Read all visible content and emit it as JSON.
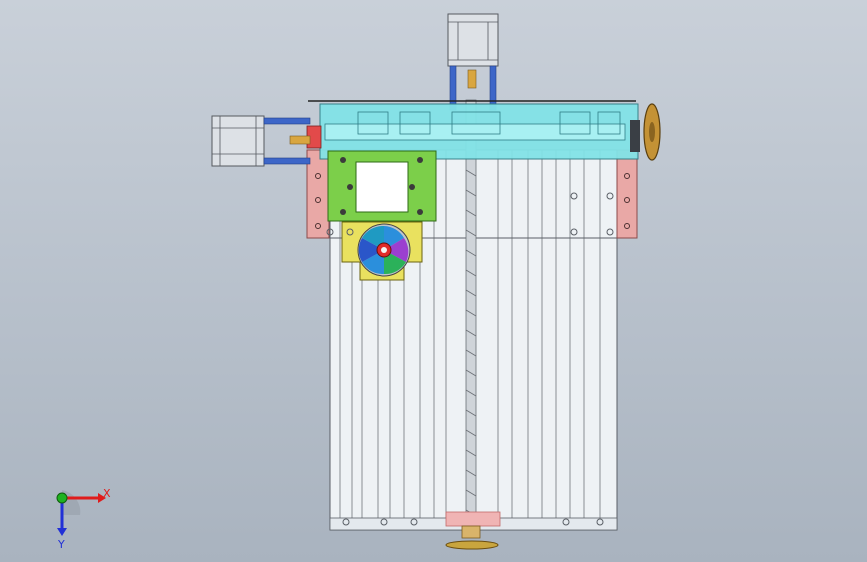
{
  "viewport": {
    "background_top": "#c9d0d9",
    "background_bottom": "#a9b3bf"
  },
  "model": {
    "colors": {
      "frame": "#e9eef2",
      "frame_line": "#5a5f66",
      "cyan_assembly": "#7fe3e6",
      "green_block": "#7cd44a",
      "pink_plate": "#e5a7a6",
      "yellow_bracket": "#e8df5a",
      "motor_body": "#d9dde2",
      "handwheel": "#b8872d",
      "red_part": "#e02a2a",
      "blue_rod": "#3a63c8"
    },
    "icons": [
      "stepper-motor-icon",
      "handwheel-icon",
      "fan-icon",
      "lead-screw-icon"
    ]
  },
  "triad": {
    "x_label": "X",
    "y_label": "Y",
    "x_color": "#e01b1b",
    "y_color": "#2130d6",
    "z_color": "#1fb21f"
  }
}
